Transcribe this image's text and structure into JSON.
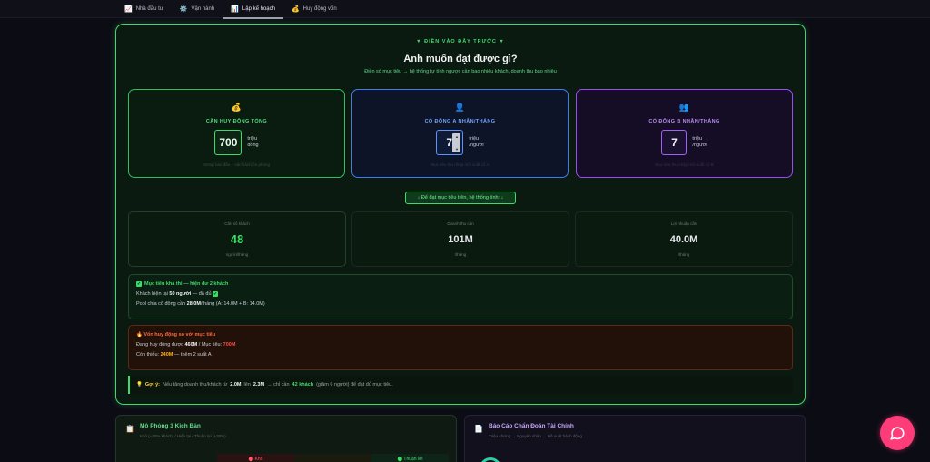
{
  "nav": {
    "tabs": [
      {
        "icon": "📈",
        "label": "Nhà đầu tư"
      },
      {
        "icon": "⚙️",
        "label": "Vận hành"
      },
      {
        "icon": "📊",
        "label": "Lập kế hoạch"
      },
      {
        "icon": "💰",
        "label": "Huy động vốn"
      }
    ]
  },
  "planner": {
    "hint": "▼ ĐIỀN VÀO ĐÂY TRƯỚC ▼",
    "heading": "Anh muốn đạt được gì?",
    "subheading": "Điền số mục tiêu → hệ thống tự tính ngược cần bao nhiêu khách, doanh thu bao nhiêu",
    "cards": [
      {
        "icon": "💰",
        "title": "CẦN HUY ĐỘNG TỔNG",
        "value": "700",
        "unit_line1": "triệu",
        "unit_line2": "đồng",
        "note": "Setup ban đầu + vận hành ổn phòng"
      },
      {
        "icon": "👤",
        "title": "CỔ ĐÔNG A NHẬN/THÁNG",
        "value": "7",
        "unit_line1": "triệu",
        "unit_line2": "/người",
        "note": "Mục tiêu thu nhập mỗi suất cổ A"
      },
      {
        "icon": "👥",
        "title": "CỔ ĐÔNG B NHẬN/THÁNG",
        "value": "7",
        "unit_line1": "triệu",
        "unit_line2": "/người",
        "note": "Mục tiêu thu nhập mỗi suất cổ B"
      }
    ],
    "calc_label": "↓ Để đạt mục tiêu trên, hệ thống tính: ↓",
    "results": [
      {
        "label": "Cần số khách",
        "value": "48",
        "unit": "người/tháng"
      },
      {
        "label": "Doanh thu cần",
        "value": "101M",
        "unit": "/tháng"
      },
      {
        "label": "Lợi nhuận cần",
        "value": "40.0M",
        "unit": "/tháng"
      }
    ],
    "ok": {
      "title": "Mục tiêu khả thi — hiện dư 2 khách",
      "line1_prefix": "Khách hiện tại",
      "line1_value": "50 người",
      "line1_suffix": "— đã đủ",
      "line2_prefix": "Pool chia cổ đông cần",
      "line2_value": "28.0M",
      "line2_suffix": "/tháng (A: 14.0M + B: 14.0M)"
    },
    "warn": {
      "title": "🔥 Vốn huy động so với mục tiêu",
      "line1_prefix": "Đang huy động được",
      "line1_value": "460M",
      "line1_mid": "/ Mục tiêu:",
      "line1_target": "700M",
      "line2_prefix": "Còn thiếu:",
      "line2_value": "240M",
      "line2_suffix": "— thêm 2 suất A"
    },
    "suggestion": {
      "icon": "💡",
      "label": "Gợi ý:",
      "t1": "Nếu tăng doanh thu/khách từ",
      "v1": "2.0M",
      "t2": "lên",
      "v2": "2.3M",
      "t3": "→ chỉ cần",
      "v3": "42 khách",
      "t4": "(giảm 6 người) để đạt đủ mục tiêu."
    }
  },
  "scenario": {
    "icon": "📋",
    "title": "Mô Phỏng 3 Kịch Bản",
    "subtitle": "Khó (−30% khách) / Hiện tại / Thuận lợi (+30%)",
    "strip": [
      "⬤ Khó",
      "",
      "⬤ Thuận lợi"
    ]
  },
  "report": {
    "icon": "📄",
    "title": "Báo Cáo Chẩn Đoán Tài Chính",
    "subtitle": "Triệu chứng → Nguyên nhân → Đề xuất hành động"
  },
  "colors": {
    "accent": "#3ddc6a",
    "blue": "#3b7ef0",
    "purple": "#9b4cf0",
    "warn": "#ff6a3d",
    "chat": "#ff3c7a"
  },
  "chat": {
    "icon": "chat-bubble-icon"
  }
}
